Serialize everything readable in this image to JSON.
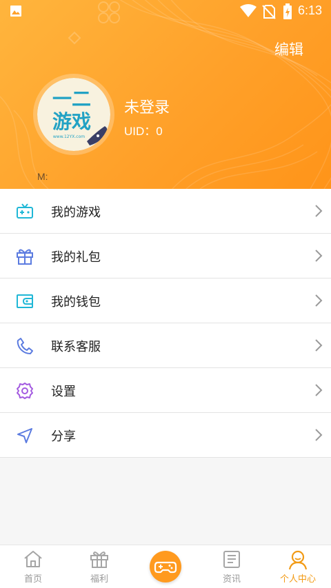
{
  "status_bar": {
    "time": "6:13",
    "icons": [
      "image-icon",
      "wifi-icon",
      "no-sim-icon",
      "battery-charging-icon"
    ]
  },
  "header": {
    "edit_label": "编辑",
    "username": "未登录",
    "uid": "UID：0",
    "m_label": "M:",
    "avatar_text": {
      "top": "一二",
      "main": "游戏",
      "sub": "www.12YX.com"
    }
  },
  "menu": [
    {
      "label": "我的游戏",
      "icon": "gamepad-icon",
      "color": "#1fb7d6"
    },
    {
      "label": "我的礼包",
      "icon": "gift-icon",
      "color": "#5b7be0"
    },
    {
      "label": "我的钱包",
      "icon": "wallet-icon",
      "color": "#1fb7d6"
    },
    {
      "label": "联系客服",
      "icon": "phone-icon",
      "color": "#5b7be0"
    },
    {
      "label": "设置",
      "icon": "settings-icon",
      "color": "#a35ae0"
    },
    {
      "label": "分享",
      "icon": "share-icon",
      "color": "#5b7be0"
    }
  ],
  "tabs": [
    {
      "label": "首页",
      "icon": "home-icon"
    },
    {
      "label": "福利",
      "icon": "gift-icon"
    },
    {
      "label": "",
      "icon": "gamepad-icon"
    },
    {
      "label": "资讯",
      "icon": "news-icon"
    },
    {
      "label": "个人中心",
      "icon": "user-icon",
      "active": true
    }
  ],
  "colors": {
    "accent": "#ff9a1f",
    "active_tab": "#f29a14"
  }
}
